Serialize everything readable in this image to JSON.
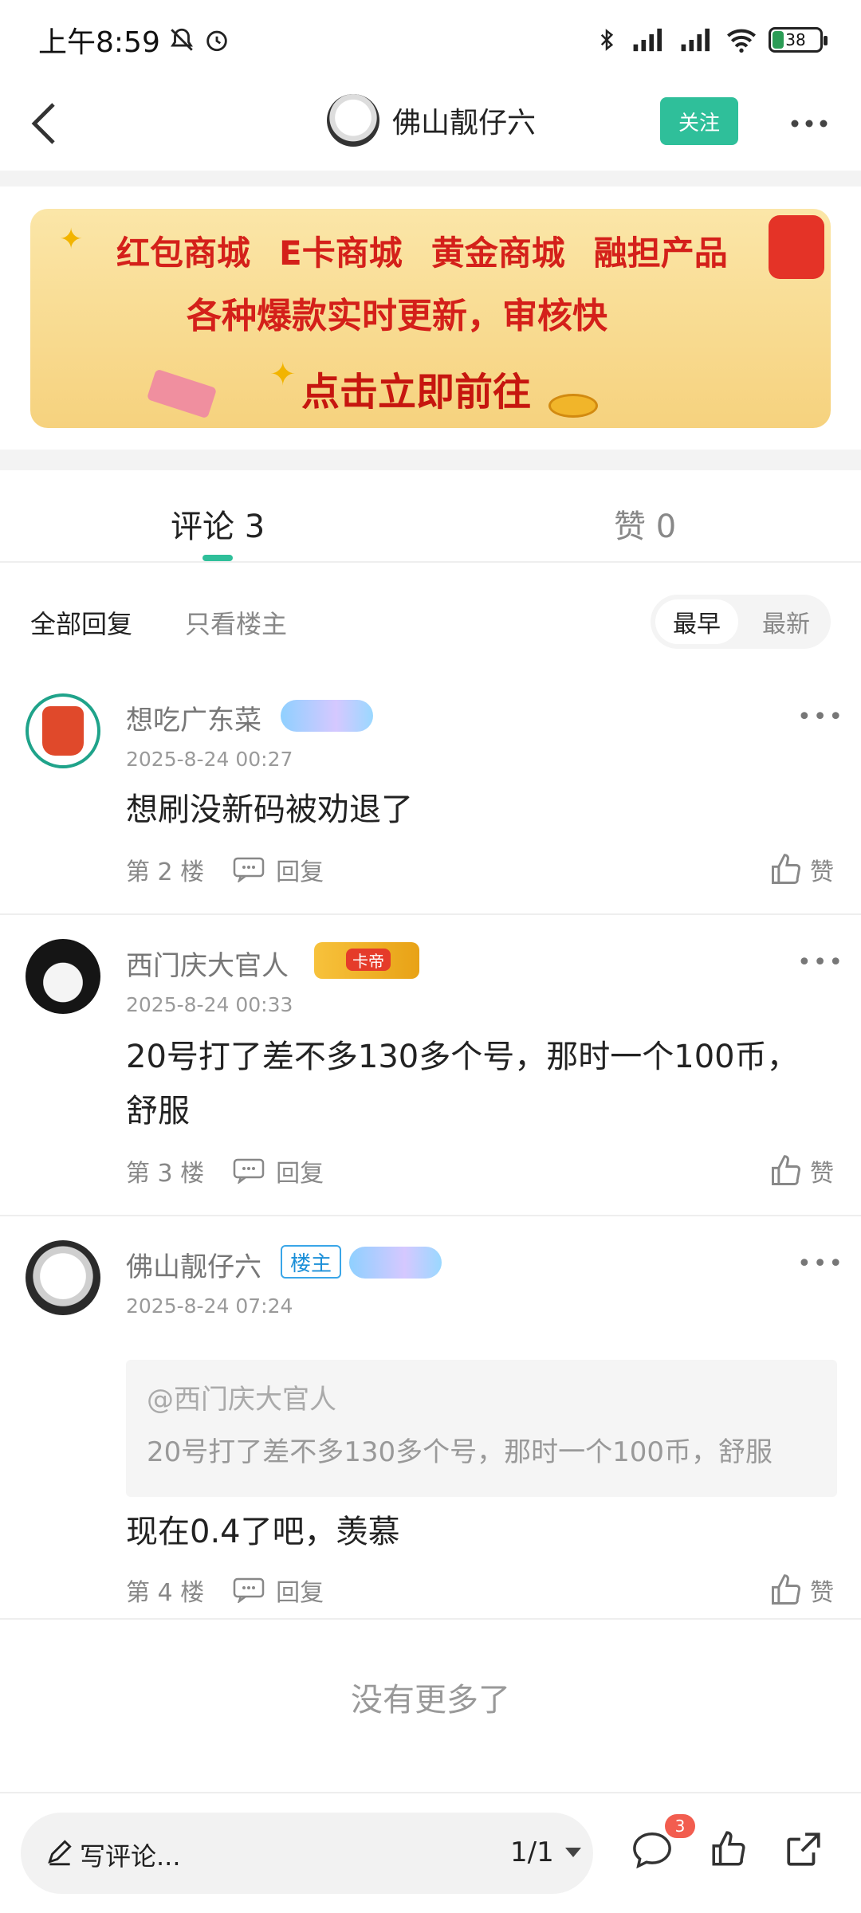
{
  "status": {
    "time": "上午8:59",
    "battery": "38"
  },
  "nav": {
    "title": "佛山靓仔六",
    "follow_label": "关注"
  },
  "banner": {
    "line1": [
      "红包商城",
      "E卡商城",
      "黄金商城",
      "融担产品"
    ],
    "line2": "各种爆款实时更新，审核快",
    "cta": "点击立即前往"
  },
  "tabs": {
    "comments": "评论 3",
    "likes": "赞 0"
  },
  "filters": {
    "all": "全部回复",
    "op_only": "只看楼主",
    "sort_early": "最早",
    "sort_new": "最新"
  },
  "comments": [
    {
      "user": "想吃广东菜",
      "time": "2025-8-24 00:27",
      "text": "想刷没新码被劝退了",
      "floor": "第 2 楼",
      "reply": "回复",
      "like": "赞"
    },
    {
      "user": "西门庆大官人",
      "badge": "卡帝",
      "time": "2025-8-24 00:33",
      "text": "20号打了差不多130多个号，那时一个100币，舒服",
      "floor": "第 3 楼",
      "reply": "回复",
      "like": "赞"
    },
    {
      "user": "佛山靓仔六",
      "op_badge": "楼主",
      "time": "2025-8-24 07:24",
      "quote_user": "@西门庆大官人",
      "quote_text": "20号打了差不多130多个号，那时一个100币，舒服",
      "text": "现在0.4了吧，羡慕",
      "floor": "第 4 楼",
      "reply": "回复",
      "like": "赞"
    }
  ],
  "footer": {
    "no_more": "没有更多了"
  },
  "bottom": {
    "placeholder": "写评论...",
    "page": "1/1",
    "comment_count": "3"
  },
  "colors": {
    "accent": "#2fbf9a",
    "badge_red": "#f25d4f"
  }
}
